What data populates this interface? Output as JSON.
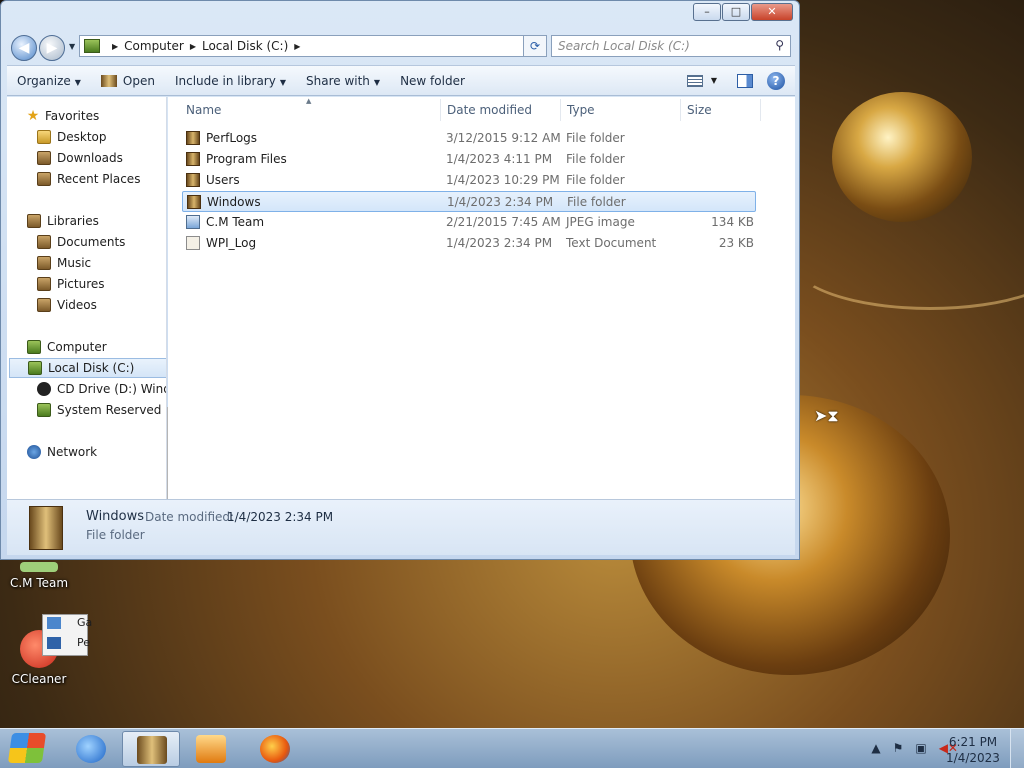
{
  "window": {
    "caption_buttons": {
      "minimize": "–",
      "maximize": "□",
      "close": "✕"
    }
  },
  "nav": {
    "back_glyph": "◀",
    "forward_glyph": "▶",
    "address": {
      "segments": [
        "Computer",
        "Local Disk (C:)"
      ]
    },
    "search_placeholder": "Search Local Disk (C:)"
  },
  "toolbar": {
    "organize": "Organize",
    "open": "Open",
    "include_in_library": "Include in library",
    "share_with": "Share with",
    "new_folder": "New folder",
    "help_glyph": "?"
  },
  "nav_pane": {
    "favorites": {
      "label": "Favorites",
      "items": [
        "Desktop",
        "Downloads",
        "Recent Places"
      ]
    },
    "libraries": {
      "label": "Libraries",
      "items": [
        "Documents",
        "Music",
        "Pictures",
        "Videos"
      ]
    },
    "computer": {
      "label": "Computer",
      "items": [
        "Local Disk (C:)",
        "CD Drive (D:) Windo",
        "System Reserved (Q:"
      ]
    },
    "network": {
      "label": "Network"
    }
  },
  "columns": {
    "name": "Name",
    "date": "Date modified",
    "type": "Type",
    "size": "Size"
  },
  "files": [
    {
      "name": "PerfLogs",
      "date": "3/12/2015 9:12 AM",
      "type": "File folder",
      "size": ""
    },
    {
      "name": "Program Files",
      "date": "1/4/2023 4:11 PM",
      "type": "File folder",
      "size": ""
    },
    {
      "name": "Users",
      "date": "1/4/2023 10:29 PM",
      "type": "File folder",
      "size": ""
    },
    {
      "name": "Windows",
      "date": "1/4/2023 2:34 PM",
      "type": "File folder",
      "size": ""
    },
    {
      "name": "C.M Team",
      "date": "2/21/2015 7:45 AM",
      "type": "JPEG image",
      "size": "134 KB"
    },
    {
      "name": "WPI_Log",
      "date": "1/4/2023 2:34 PM",
      "type": "Text Document",
      "size": "23 KB"
    }
  ],
  "details": {
    "name": "Windows",
    "modified_label": "Date modified:",
    "modified_value": "1/4/2023 2:34 PM",
    "type": "File folder"
  },
  "desktop_icons": {
    "cm_team": "C.M Team",
    "ccleaner": "CCleaner",
    "frag1": "Ga",
    "frag2": "Pe"
  },
  "taskbar": {
    "time": "6:21 PM",
    "date": "1/4/2023"
  }
}
